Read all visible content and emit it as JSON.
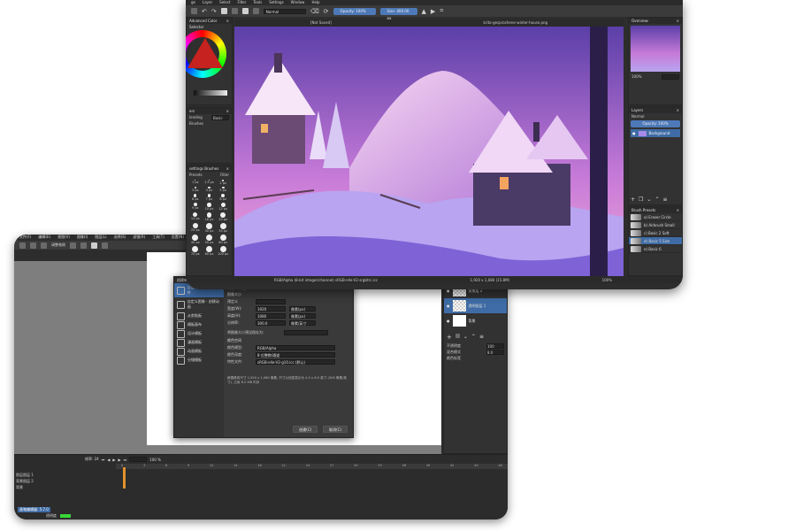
{
  "front": {
    "menu": [
      "ge",
      "Layer",
      "Select",
      "Filter",
      "Tools",
      "Settings",
      "Window",
      "Help"
    ],
    "blend_mode": "Normal",
    "opacity": "Opacity: 100%",
    "size": "Size: 400.00 px",
    "tabs": [
      "[Not Saved]",
      "krita-gesprochene-winter-house.png"
    ],
    "left_panels": {
      "color_selector": "Advanced Color Selector",
      "layers_label": "ers",
      "blending_label": "lending",
      "blending_value": "Basic",
      "brushes_label": "Brushes",
      "settings_label": "settings Brushes",
      "presets_tab": "Presets",
      "filter_tab": "Filter",
      "sizes": [
        "1 px",
        "1.5 px",
        "2 px",
        "3 px",
        "4 px",
        "5 px",
        "6 px",
        "7 px",
        "8 px",
        "9 px",
        "10 px",
        "12 px",
        "14 px",
        "16 px",
        "20 px",
        "25 px",
        "30 px",
        "35 px",
        "40 px",
        "50 px",
        "60 px",
        "70 px",
        "80 px",
        "100 px"
      ]
    },
    "right_panels": {
      "overview": "Overview",
      "zoom": "100%",
      "layers": "Layers",
      "layer_mode": "Normal",
      "layer_opacity": "Opacity: 100%",
      "layer_name": "Background",
      "brush_presets": "Brush Presets",
      "brush_items": [
        "a) Eraser Circle",
        "b) Airbrush Small",
        "c) Basic 2 Soft",
        "d) Basic 5 Size",
        "e) Basic 6"
      ]
    },
    "status": "RGB/Alpha (8-bit integer/channel) sRGB-elle-V2-srgbtrc.icc",
    "status_right": "1,920 x 1,080 (15.8M)",
    "status_zoom": "100%"
  },
  "back": {
    "menu": [
      "文件(F)",
      "编辑(E)",
      "视图(V)",
      "图像(I)",
      "图层(L)",
      "选择(S)",
      "滤镜(R)",
      "工具(T)",
      "设置(N)",
      "窗口(W)",
      "帮助(H)"
    ],
    "toolbar_label": "调整笔刷",
    "dialog": {
      "title": "创建新文件",
      "sidebar": [
        {
          "label": "自定义文档 - 创建文件",
          "active": true
        },
        {
          "label": "自定义图像 - 创建动画",
          "active": false
        },
        {
          "label": "从剪贴板",
          "active": false
        },
        {
          "label": "模板画布",
          "active": false
        },
        {
          "label": "设计模板",
          "active": false
        },
        {
          "label": "漫画模板",
          "active": false
        },
        {
          "label": "动画模板",
          "active": false
        },
        {
          "label": "分镜模板",
          "active": false
        }
      ],
      "tabs": [
        "尺寸",
        "内容"
      ],
      "section": "图像大小",
      "fields": [
        {
          "label": "预定义",
          "value": ""
        },
        {
          "label": "宽度(W):",
          "value": "1920"
        },
        {
          "label": "高度(H):",
          "value": "1080"
        },
        {
          "label": "分辨率:",
          "value": "300.0"
        }
      ],
      "field_units": [
        "像素(px)",
        "像素(px)",
        "像素/英寸"
      ],
      "save_label": "将图像大小预设保存为:",
      "color_section": "颜色空间",
      "color_fields": [
        {
          "label": "颜色模型:",
          "value": "RGB/Alpha"
        },
        {
          "label": "颜色深度:",
          "value": "8 位整数/通道"
        },
        {
          "label": "特性文件:",
          "value": "sRGB-elle-V2-g10.icc (默认)"
        }
      ],
      "info": "新图像将尺寸 1,920 x 1,080 像素, 尺寸以信息显示为 4.5 x 8.5 英寸 (300 像素/英寸), 占用 8.2 MB 内存",
      "ok": "创建(C)",
      "cancel": "取消(C)"
    },
    "right_panels": {
      "layer_names": [
        "背景层 2",
        "透明图层 1",
        "背景"
      ],
      "properties": [
        "不透明度",
        "混合模式",
        "颜色标签"
      ],
      "opacity_value": "100",
      "size_value": "8.0"
    },
    "timeline": {
      "layers": [
        "图层图层 1",
        "背景图层 2",
        "背景"
      ],
      "frames": [
        "0",
        "3",
        "6",
        "9",
        "12",
        "15",
        "18",
        "21",
        "24",
        "27",
        "30",
        "33",
        "36",
        "39",
        "42",
        "45",
        "48"
      ],
      "fps_label": "帧率: 24",
      "zoom": "100 %",
      "bottom_label": "画笔编辑器: 5.7.0",
      "bottom_right": "透明度"
    }
  },
  "colors": {
    "accent": "#4d79b8",
    "panel": "#323232",
    "sky_top": "#5b3fa8",
    "sky_bottom": "#f1a6d8",
    "snow": "#b8a4f0"
  }
}
